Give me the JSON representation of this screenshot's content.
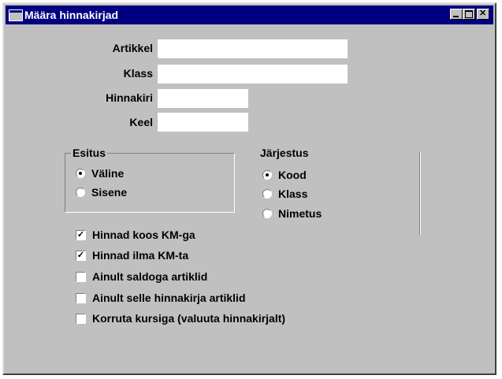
{
  "window": {
    "title": "Määra hinnakirjad"
  },
  "fields": {
    "artikkel": {
      "label": "Artikkel",
      "value": ""
    },
    "klass": {
      "label": "Klass",
      "value": ""
    },
    "hinnakiri": {
      "label": "Hinnakiri",
      "value": ""
    },
    "keel": {
      "label": "Keel",
      "value": ""
    }
  },
  "esitus": {
    "title": "Esitus",
    "options": [
      {
        "label": "Väline",
        "selected": true
      },
      {
        "label": "Sisene",
        "selected": false
      }
    ]
  },
  "jarjestus": {
    "title": "Järjestus",
    "options": [
      {
        "label": "Kood",
        "selected": true
      },
      {
        "label": "Klass",
        "selected": false
      },
      {
        "label": "Nimetus",
        "selected": false
      }
    ]
  },
  "checkboxes": [
    {
      "label": "Hinnad koos KM-ga",
      "checked": true
    },
    {
      "label": "Hinnad ilma KM-ta",
      "checked": true
    },
    {
      "label": "Ainult saldoga artiklid",
      "checked": false
    },
    {
      "label": "Ainult selle hinnakirja artiklid",
      "checked": false
    },
    {
      "label": "Korruta kursiga (valuuta hinnakirjalt)",
      "checked": false
    }
  ]
}
